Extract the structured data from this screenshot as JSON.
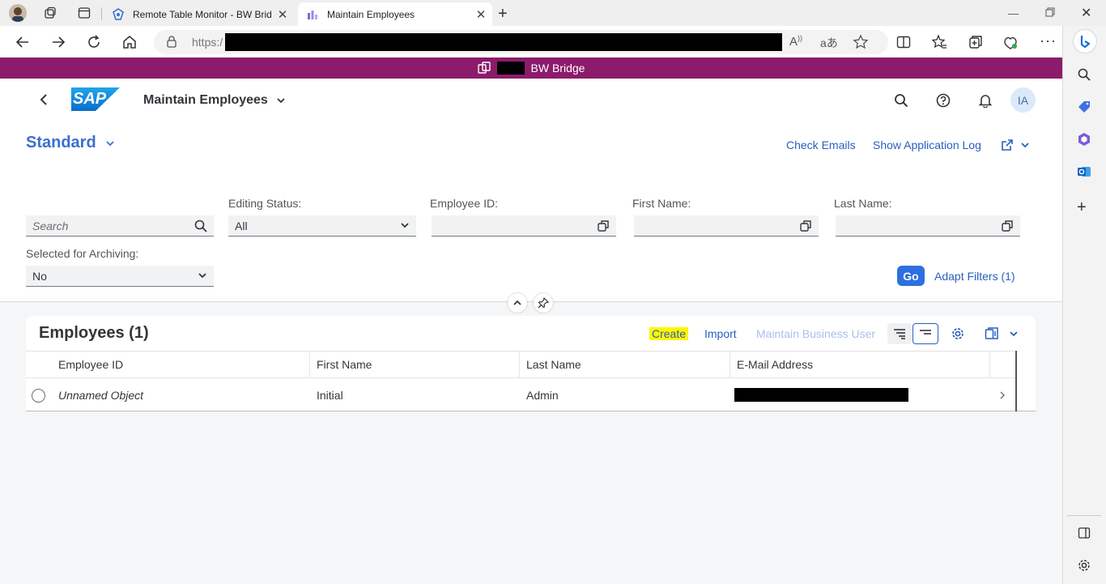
{
  "browser": {
    "tabs": [
      {
        "title": "Remote Table Monitor - BW Bridge"
      },
      {
        "title": "Maintain Employees"
      }
    ],
    "url_prefix": "https:/"
  },
  "tenant_bar": {
    "label": "BW Bridge"
  },
  "shell": {
    "logo_text": "SAP",
    "app_title": "Maintain Employees",
    "avatar": "IA"
  },
  "header": {
    "variant": "Standard",
    "links": {
      "check_emails": "Check Emails",
      "show_log": "Show Application Log"
    }
  },
  "filters": {
    "search_placeholder": "Search",
    "editing_status": {
      "label": "Editing Status:",
      "value": "All"
    },
    "employee_id": {
      "label": "Employee ID:"
    },
    "first_name": {
      "label": "First Name:"
    },
    "last_name": {
      "label": "Last Name:"
    },
    "archiving": {
      "label": "Selected for Archiving:",
      "value": "No"
    },
    "go": "Go",
    "adapt": "Adapt Filters (1)"
  },
  "table": {
    "title": "Employees (1)",
    "buttons": {
      "create": "Create",
      "import": "Import",
      "maintain": "Maintain Business User"
    },
    "columns": [
      "Employee ID",
      "First Name",
      "Last Name",
      "E-Mail Address"
    ],
    "rows": [
      {
        "employee_id": "Unnamed Object",
        "first_name": "Initial",
        "last_name": "Admin"
      }
    ]
  },
  "colors": {
    "tenant": "#8c1b6b",
    "accent": "#2a5ebd",
    "highlight": "#fff600"
  }
}
